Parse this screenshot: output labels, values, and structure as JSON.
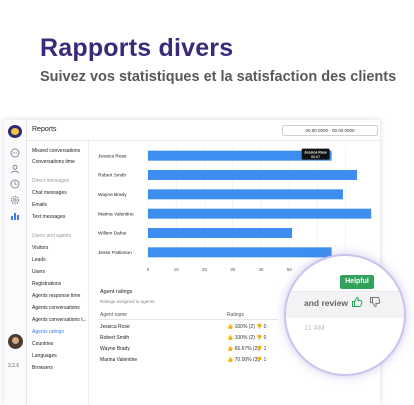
{
  "hero": {
    "title": "Rapports divers",
    "subtitle": "Suivez vos statistiques et la  satisfaction des clients"
  },
  "app": {
    "page_title": "Reports",
    "date_range": "00.00.0000 - 00.00.0000",
    "version": "3.2.6",
    "rail_icons": [
      "chat-icon",
      "contacts-icon",
      "clock-icon",
      "settings-icon",
      "reports-icon"
    ],
    "nav": [
      {
        "label": "Missed conversations",
        "type": "item"
      },
      {
        "label": "Conversations time",
        "type": "item"
      },
      {
        "label": "Direct messages",
        "type": "section"
      },
      {
        "label": "Chat messages",
        "type": "item"
      },
      {
        "label": "Emails",
        "type": "item"
      },
      {
        "label": "Text messages",
        "type": "item"
      },
      {
        "label": "Users and agents",
        "type": "section"
      },
      {
        "label": "Visitors",
        "type": "item"
      },
      {
        "label": "Leads",
        "type": "item"
      },
      {
        "label": "Users",
        "type": "item"
      },
      {
        "label": "Registrations",
        "type": "item"
      },
      {
        "label": "Agents response time",
        "type": "item"
      },
      {
        "label": "Agents conversations",
        "type": "item"
      },
      {
        "label": "Agents conversations t...",
        "type": "item"
      },
      {
        "label": "Agents ratings",
        "type": "active"
      },
      {
        "label": "Countries",
        "type": "item"
      },
      {
        "label": "Languages",
        "type": "item"
      },
      {
        "label": "Browsers",
        "type": "item"
      }
    ]
  },
  "chart_data": {
    "type": "bar",
    "orientation": "horizontal",
    "categories": [
      "Jessica Rose",
      "Robert Smith",
      "Wayne Brady",
      "Marina Valentine",
      "Willem Dafoe",
      "Jesse Pattinson"
    ],
    "values": [
      65,
      74,
      69,
      79,
      51,
      65
    ],
    "xlim": [
      0,
      80
    ],
    "xticks": [
      "0",
      "10",
      "20",
      "30",
      "40",
      "50",
      "60",
      "70"
    ],
    "color": "#3d8ef0",
    "grid": true,
    "tooltip": {
      "category": "Jessica Rose",
      "label": "Jessica Rose",
      "value": "66.67"
    }
  },
  "ratings": {
    "title": "Agent ratings",
    "subtitle": "Ratings assigned to agents.",
    "col_agent": "Agent name",
    "col_ratings": "Ratings",
    "rows": [
      {
        "name": "Jessica Rose",
        "up": "100% (2)",
        "down": "0"
      },
      {
        "name": "Robert Smith",
        "up": "100% (2)",
        "down": "0"
      },
      {
        "name": "Wayne Brady",
        "up": "66.67% (2)",
        "down": "1"
      },
      {
        "name": "Marina Valentine",
        "up": "70.00% (3)",
        "down": "1"
      }
    ]
  },
  "zoom": {
    "helpful": "Helpful",
    "text": "and review",
    "time": "11 AM",
    "up_color": "#2fa35b",
    "down_color": "#777777"
  }
}
